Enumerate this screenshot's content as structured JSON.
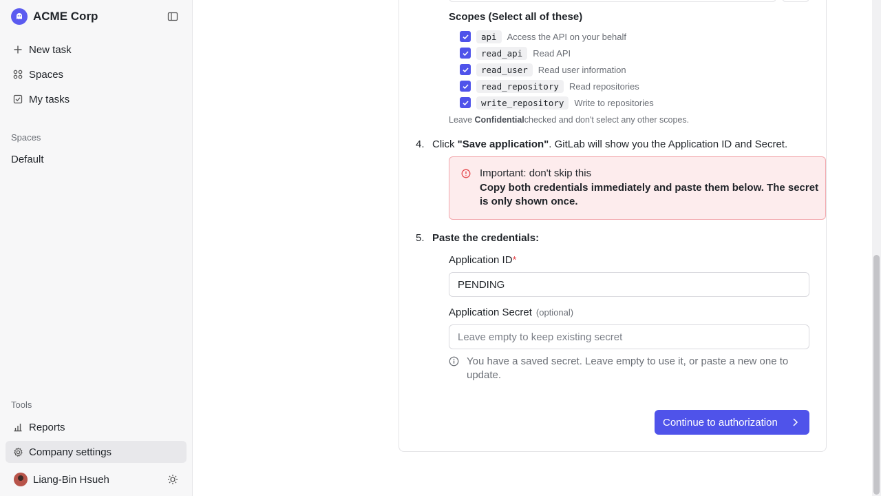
{
  "app": {
    "name": "ACME Corp"
  },
  "sidebar": {
    "nav": [
      {
        "label": "New task",
        "icon": "plus-icon"
      },
      {
        "label": "Spaces",
        "icon": "grid-icon"
      },
      {
        "label": "My tasks",
        "icon": "checkbox-icon"
      }
    ],
    "spaces_label": "Spaces",
    "spaces": [
      {
        "label": "Default"
      }
    ],
    "tools_label": "Tools",
    "tools": [
      {
        "label": "Reports",
        "icon": "bar-chart-icon"
      },
      {
        "label": "Company settings",
        "icon": "gear-icon",
        "active": true
      }
    ],
    "user": {
      "name": "Liang-Bin Hsueh"
    }
  },
  "scopes": {
    "title": "Scopes (Select all of these)",
    "items": [
      {
        "code": "api",
        "desc": "Access the API on your behalf",
        "checked": true
      },
      {
        "code": "read_api",
        "desc": "Read API",
        "checked": true
      },
      {
        "code": "read_user",
        "desc": "Read user information",
        "checked": true
      },
      {
        "code": "read_repository",
        "desc": "Read repositories",
        "checked": true
      },
      {
        "code": "write_repository",
        "desc": "Write to repositories",
        "checked": true
      }
    ],
    "note_prefix": "Leave ",
    "note_bold": "Confidential",
    "note_suffix": "checked and don't select any other scopes."
  },
  "step4": {
    "num": "4.",
    "prefix": "Click ",
    "bold": "\"Save application\"",
    "suffix": ". GitLab will show you the Application ID and Secret."
  },
  "alert": {
    "title": "Important: don't skip this",
    "body": "Copy both credentials immediately and paste them below. The secret is only shown once."
  },
  "step5": {
    "num": "5.",
    "label": "Paste the credentials:"
  },
  "form": {
    "app_id_label": "Application ID",
    "app_id_required": "*",
    "app_id_value": "PENDING",
    "secret_label": "Application Secret",
    "secret_optional": "(optional)",
    "secret_placeholder": "Leave empty to keep existing secret",
    "hint": "You have a saved secret. Leave empty to use it, or paste a new one to update."
  },
  "actions": {
    "continue_label": "Continue to authorization"
  },
  "colors": {
    "accent": "#4f53ea",
    "alert_bg": "#fdeced",
    "alert_border": "#f2a8ad",
    "required": "#e5484d"
  }
}
